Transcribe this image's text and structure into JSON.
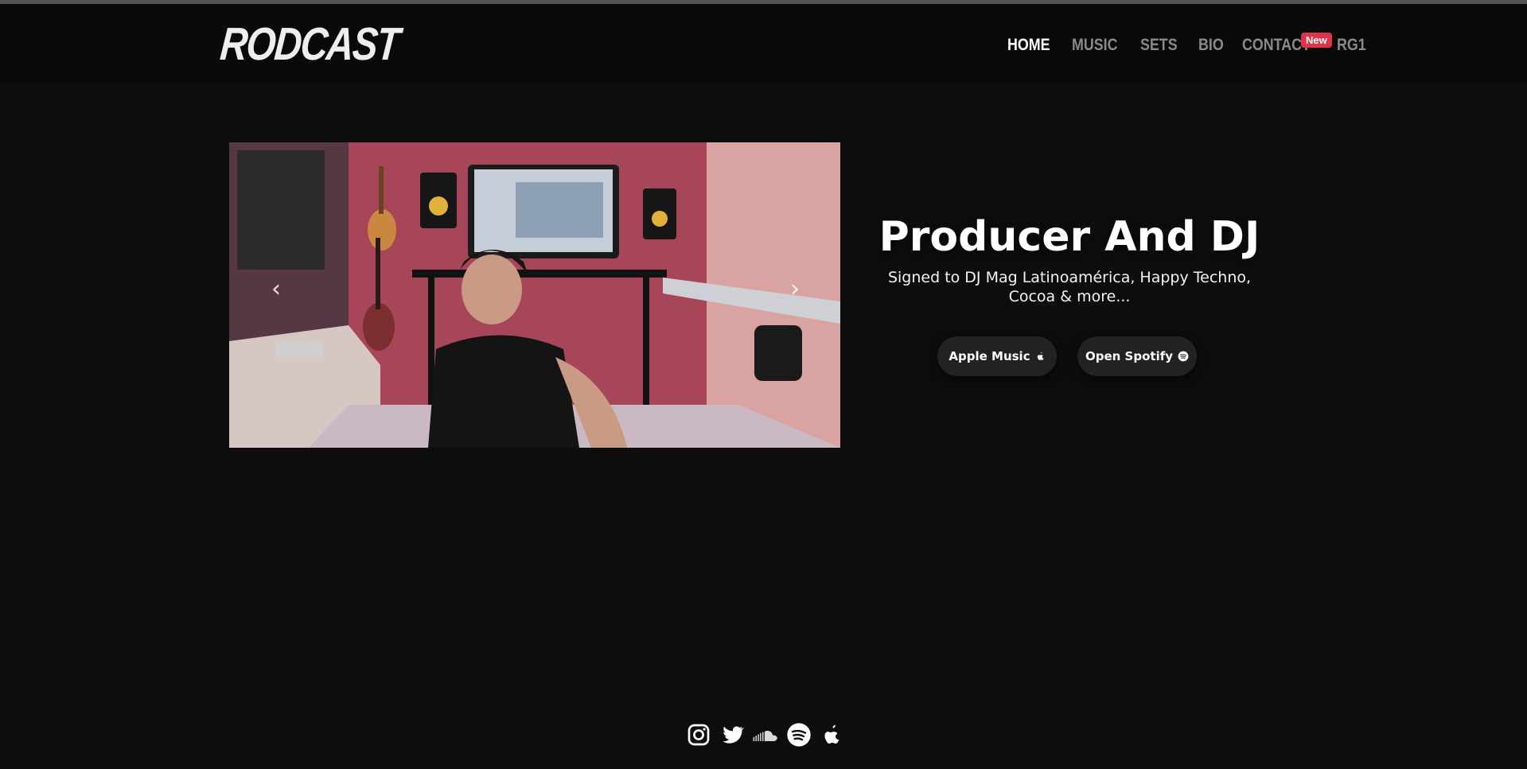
{
  "brand": {
    "logo_text": "RODCAST"
  },
  "nav": {
    "items": [
      {
        "label": "HOME",
        "active": true
      },
      {
        "label": "MUSIC",
        "active": false
      },
      {
        "label": "SETS",
        "active": false
      },
      {
        "label": "BIO",
        "active": false
      },
      {
        "label": "CONTACT",
        "active": false
      },
      {
        "label": "RG1",
        "active": false
      }
    ],
    "badge": "New"
  },
  "carousel": {
    "prev_icon": "chevron-left-icon",
    "next_icon": "chevron-right-icon"
  },
  "hero": {
    "title": "Producer And DJ",
    "subtitle": "Signed to DJ Mag Latinoamérica, Happy Techno, Cocoa & more...",
    "buttons": {
      "apple": "Apple Music",
      "spotify": "Open Spotify"
    }
  },
  "social": [
    "instagram-icon",
    "twitter-icon",
    "soundcloud-icon",
    "spotify-icon",
    "apple-icon"
  ],
  "colors": {
    "background": "#0d0d0d",
    "badge": "#e0334a",
    "button": "#222222"
  }
}
